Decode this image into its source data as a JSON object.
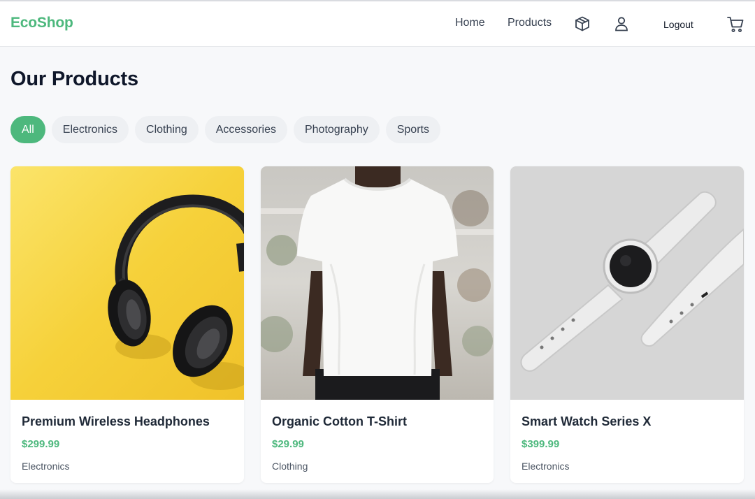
{
  "header": {
    "logo": "EcoShop",
    "nav": {
      "home": "Home",
      "products": "Products"
    },
    "icons": [
      "box-icon",
      "user-icon",
      "cart-icon"
    ],
    "logout": "Logout"
  },
  "main": {
    "title": "Our Products",
    "filters": [
      {
        "label": "All",
        "active": true
      },
      {
        "label": "Electronics",
        "active": false
      },
      {
        "label": "Clothing",
        "active": false
      },
      {
        "label": "Accessories",
        "active": false
      },
      {
        "label": "Photography",
        "active": false
      },
      {
        "label": "Sports",
        "active": false
      }
    ],
    "products": [
      {
        "name": "Premium Wireless Headphones",
        "price": "$299.99",
        "category": "Electronics",
        "image": "headphones-image"
      },
      {
        "name": "Organic Cotton T-Shirt",
        "price": "$29.99",
        "category": "Clothing",
        "image": "tshirt-image"
      },
      {
        "name": "Smart Watch Series X",
        "price": "$399.99",
        "category": "Electronics",
        "image": "smartwatch-image"
      }
    ]
  },
  "colors": {
    "accent": "#4db87d",
    "background": "#f7f8fa",
    "chip": "#eef0f3",
    "text": "#111827"
  }
}
